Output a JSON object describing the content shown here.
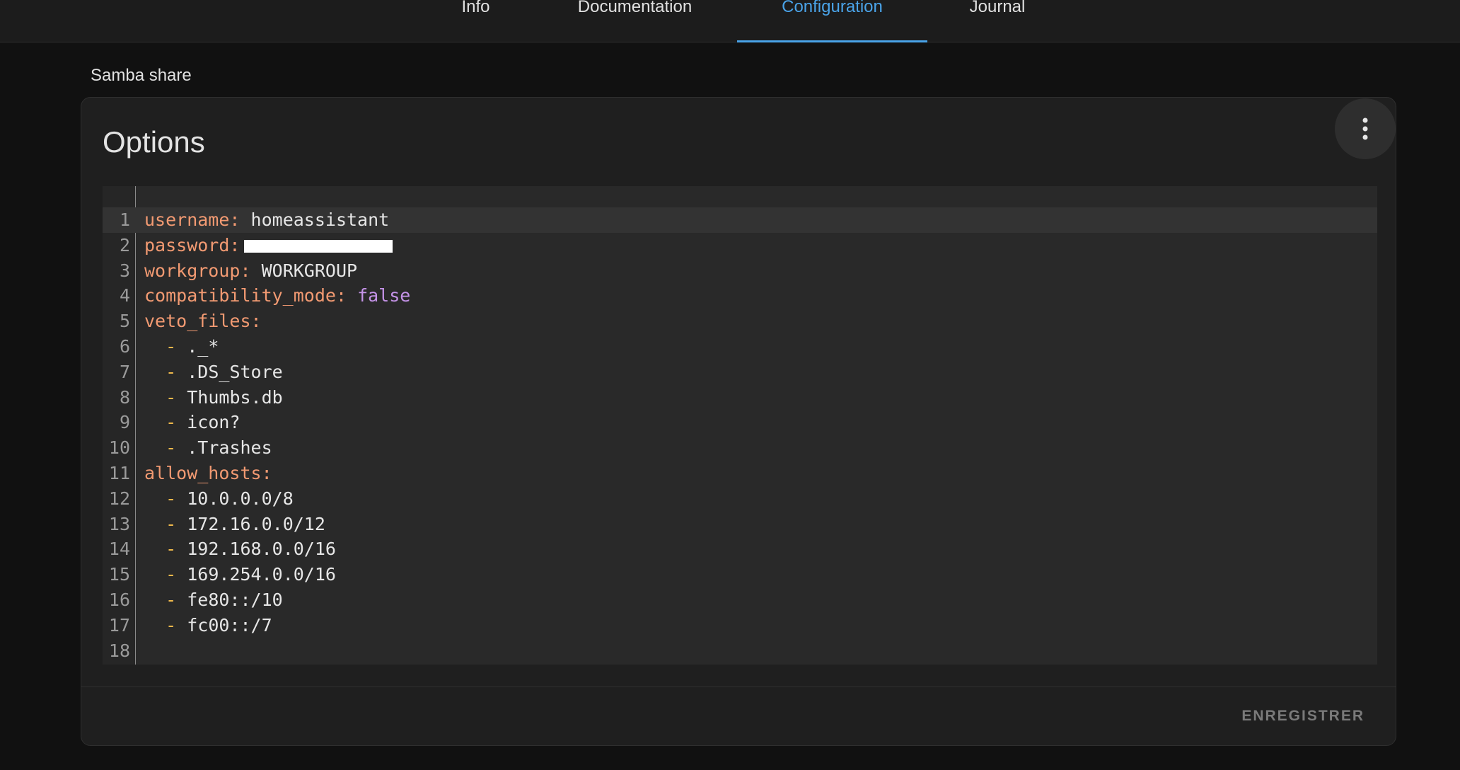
{
  "tabs": [
    {
      "label": "Info",
      "active": false
    },
    {
      "label": "Documentation",
      "active": false
    },
    {
      "label": "Configuration",
      "active": true
    },
    {
      "label": "Journal",
      "active": false
    }
  ],
  "section_title": "Samba share",
  "card": {
    "title": "Options",
    "menu_icon": "dots-vertical-icon",
    "save_label": "ENREGISTRER"
  },
  "editor": {
    "lines": [
      {
        "n": "1",
        "key": "username",
        "value": "homeassistant"
      },
      {
        "n": "2",
        "key": "password",
        "value": ""
      },
      {
        "n": "3",
        "key": "workgroup",
        "value": "WORKGROUP"
      },
      {
        "n": "4",
        "key": "compatibility_mode",
        "value": "false"
      },
      {
        "n": "5",
        "key": "veto_files",
        "value": ""
      },
      {
        "n": "6",
        "item": "._*"
      },
      {
        "n": "7",
        "item": ".DS_Store"
      },
      {
        "n": "8",
        "item": "Thumbs.db"
      },
      {
        "n": "9",
        "item": "icon?"
      },
      {
        "n": "10",
        "item": ".Trashes"
      },
      {
        "n": "11",
        "key": "allow_hosts",
        "value": ""
      },
      {
        "n": "12",
        "item": "10.0.0.0/8"
      },
      {
        "n": "13",
        "item": "172.16.0.0/12"
      },
      {
        "n": "14",
        "item": "192.168.0.0/16"
      },
      {
        "n": "15",
        "item": "169.254.0.0/16"
      },
      {
        "n": "16",
        "item": "fe80::/10"
      },
      {
        "n": "17",
        "item": "fc00::/7"
      },
      {
        "n": "18"
      }
    ]
  },
  "colors": {
    "accent": "#4aa3e8",
    "yaml_key": "#f29a72",
    "yaml_bool": "#c593e8",
    "yaml_dash": "#f0b94b"
  }
}
